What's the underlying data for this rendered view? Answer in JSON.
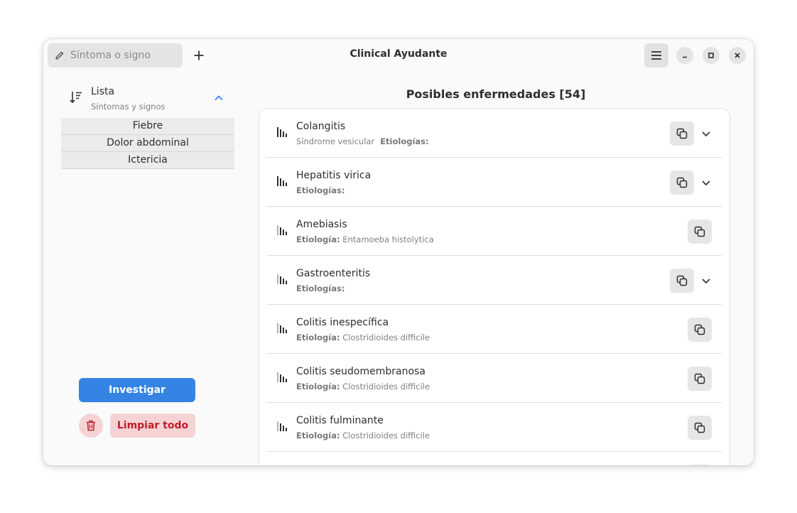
{
  "header": {
    "search_placeholder": "Síntoma o signo",
    "title": "Clinical Ayudante"
  },
  "sidebar": {
    "list_title": "Lista",
    "list_subtitle": "Síntomas y signos",
    "symptoms": [
      "Fiebre",
      "Dolor abdominal",
      "Ictericia"
    ],
    "investigate_label": "Investigar",
    "clear_label": "Limpiar todo"
  },
  "main": {
    "title": "Posibles enfermedades [54]",
    "diseases": [
      {
        "name": "Colangitis",
        "syndrome": "Síndrome vesicular",
        "etiology_label": "Etiologías:",
        "etiology": "",
        "expandable": true,
        "score": 4
      },
      {
        "name": "Hepatitis virica",
        "syndrome": "",
        "etiology_label": "Etiologías:",
        "etiology": "",
        "expandable": true,
        "score": 4
      },
      {
        "name": "Amebiasis",
        "syndrome": "",
        "etiology_label": "Etiología:",
        "etiology": "Entamoeba histolytica",
        "expandable": false,
        "score": 3
      },
      {
        "name": "Gastroenteritis",
        "syndrome": "",
        "etiology_label": "Etiologías:",
        "etiology": "",
        "expandable": true,
        "score": 3
      },
      {
        "name": "Colitis inespecífica",
        "syndrome": "",
        "etiology_label": "Etiología:",
        "etiology": "Clostridioides difficile",
        "expandable": false,
        "score": 3
      },
      {
        "name": "Colitis seudomembranosa",
        "syndrome": "",
        "etiology_label": "Etiología:",
        "etiology": "Clostridioides difficile",
        "expandable": false,
        "score": 3
      },
      {
        "name": "Colitis fulminante",
        "syndrome": "",
        "etiology_label": "Etiología:",
        "etiology": "Clostridioides difficile",
        "expandable": false,
        "score": 3
      }
    ]
  },
  "colors": {
    "accent": "#3584e4",
    "destructive": "#c01c28",
    "destructive_bg": "#f5d3d5"
  }
}
